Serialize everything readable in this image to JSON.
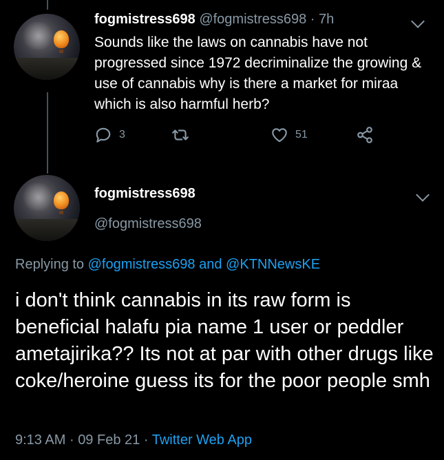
{
  "tweet1": {
    "display_name": "fogmistress698",
    "handle": "@fogmistress698",
    "separator": "·",
    "time": "7h",
    "text": "Sounds like the laws on cannabis have not progressed since 1972 decriminalize the growing & use of cannabis why is there a market for miraa which is also harmful herb?",
    "reply_count": "3",
    "like_count": "51",
    "icons": [
      "reply-icon",
      "retweet-icon",
      "like-icon",
      "share-icon",
      "chevron-down-icon"
    ]
  },
  "tweet2": {
    "display_name": "fogmistress698",
    "handle": "@fogmistress698",
    "replying_prefix": "Replying to",
    "replying_user1": "@fogmistress698",
    "replying_and": "and",
    "replying_user2": "@KTNNewsKE",
    "text": "i don't think cannabis in its raw form is beneficial halafu pia name 1 user or peddler ametajirika?? Its not at par with other drugs like coke/heroine guess its for the poor people smh",
    "time": "9:13 AM",
    "sep1": "·",
    "date": "09 Feb 21",
    "sep2": "·",
    "source": "Twitter Web App"
  },
  "colors": {
    "background": "#000000",
    "text": "#ffffff",
    "muted": "#8899a6",
    "link": "#1da1f2",
    "thread_line": "#3d5466"
  }
}
